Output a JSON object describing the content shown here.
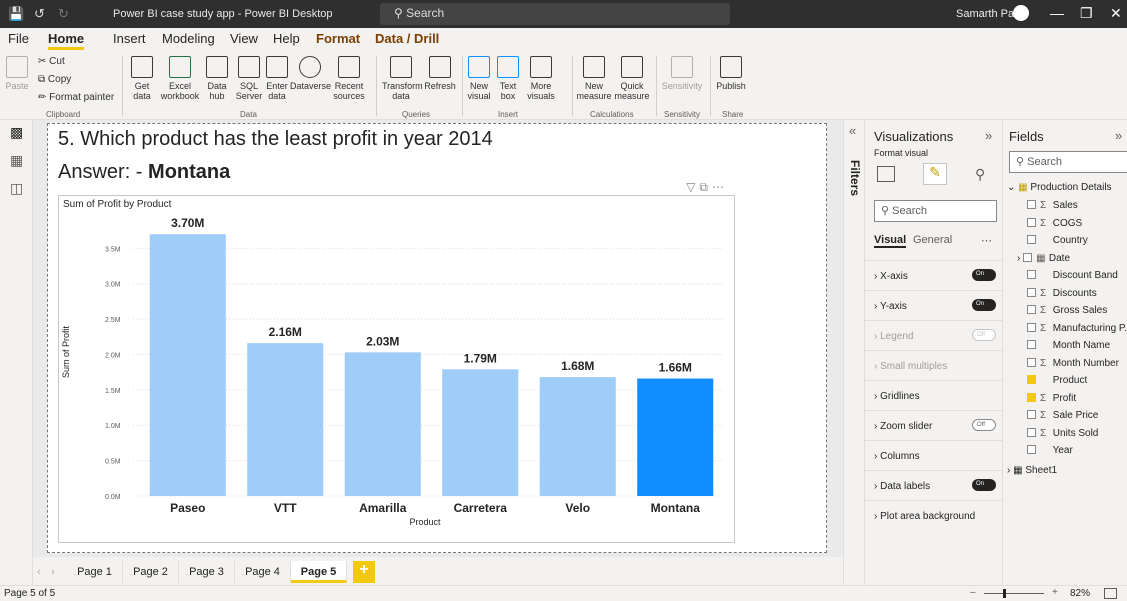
{
  "titlebar": {
    "doc_title": "Power BI case study app - Power BI Desktop",
    "search_placeholder": "Search",
    "user": "Samarth Patil"
  },
  "menu": [
    "File",
    "Home",
    "Insert",
    "Modeling",
    "View",
    "Help",
    "Format",
    "Data / Drill"
  ],
  "ribbon": {
    "clipboard": {
      "paste": "Paste",
      "cut": "Cut",
      "copy": "Copy",
      "format_painter": "Format painter",
      "group": "Clipboard"
    },
    "data": {
      "items": [
        "Get data",
        "Excel workbook",
        "Data hub",
        "SQL Server",
        "Enter data",
        "Dataverse",
        "Recent sources"
      ],
      "group": "Data"
    },
    "queries": {
      "items": [
        "Transform data",
        "Refresh"
      ],
      "group": "Queries"
    },
    "insert": {
      "items": [
        "New visual",
        "Text box",
        "More visuals"
      ],
      "group": "Insert"
    },
    "calculations": {
      "items": [
        "New measure",
        "Quick measure"
      ],
      "group": "Calculations"
    },
    "sensitivity": {
      "items": [
        "Sensitivity"
      ],
      "group": "Sensitivity"
    },
    "share": {
      "items": [
        "Publish"
      ],
      "group": "Share"
    }
  },
  "report": {
    "question": "5. Which product has the least profit in year 2014",
    "answer_prefix": "Answer: - ",
    "answer": "Montana"
  },
  "chart_data": {
    "type": "bar",
    "title": "Sum of Profit by Product",
    "xlabel": "Product",
    "ylabel": "Sum of Profit",
    "categories": [
      "Paseo",
      "VTT",
      "Amarilla",
      "Carretera",
      "Velo",
      "Montana"
    ],
    "values": [
      3.7,
      2.16,
      2.03,
      1.79,
      1.68,
      1.66
    ],
    "value_unit": "M",
    "data_labels": [
      "3.70M",
      "2.16M",
      "2.03M",
      "1.79M",
      "1.68M",
      "1.66M"
    ],
    "y_ticks": [
      "0.0M",
      "0.5M",
      "1.0M",
      "1.5M",
      "2.0M",
      "2.5M",
      "3.0M",
      "3.5M"
    ],
    "ylim": [
      0,
      3.9
    ],
    "grid": true,
    "bar_color": "#9fcdf8",
    "highlight_color": "#118dff",
    "highlight_category": "Montana"
  },
  "filters_label": "Filters",
  "visualizations": {
    "title": "Visualizations",
    "format_visual": "Format visual",
    "search_placeholder": "Search",
    "tabs": [
      "Visual",
      "General"
    ],
    "sections": [
      {
        "label": "X-axis",
        "toggle": "On",
        "state": "on"
      },
      {
        "label": "Y-axis",
        "toggle": "On",
        "state": "on"
      },
      {
        "label": "Legend",
        "toggle": "Off",
        "state": "disabled"
      },
      {
        "label": "Small multiples",
        "toggle": "",
        "state": "disabled"
      },
      {
        "label": "Gridlines",
        "toggle": "",
        "state": "normal"
      },
      {
        "label": "Zoom slider",
        "toggle": "Off",
        "state": "off"
      },
      {
        "label": "Columns",
        "toggle": "",
        "state": "normal"
      },
      {
        "label": "Data labels",
        "toggle": "On",
        "state": "on"
      },
      {
        "label": "Plot area background",
        "toggle": "",
        "state": "normal"
      }
    ]
  },
  "fields": {
    "title": "Fields",
    "search_placeholder": "Search",
    "table": "Production Details",
    "items": [
      {
        "label": "Sales",
        "sigma": true,
        "checked": false
      },
      {
        "label": "COGS",
        "sigma": true,
        "checked": false
      },
      {
        "label": "Country",
        "sigma": false,
        "checked": false
      },
      {
        "label": "Date",
        "sigma": false,
        "checked": false,
        "hierarchy": true
      },
      {
        "label": "Discount Band",
        "sigma": false,
        "checked": false
      },
      {
        "label": "Discounts",
        "sigma": true,
        "checked": false
      },
      {
        "label": "Gross Sales",
        "sigma": true,
        "checked": false
      },
      {
        "label": "Manufacturing P...",
        "sigma": true,
        "checked": false
      },
      {
        "label": "Month Name",
        "sigma": false,
        "checked": false
      },
      {
        "label": "Month Number",
        "sigma": true,
        "checked": false
      },
      {
        "label": "Product",
        "sigma": false,
        "checked": true
      },
      {
        "label": "Profit",
        "sigma": true,
        "checked": true
      },
      {
        "label": "Sale Price",
        "sigma": true,
        "checked": false
      },
      {
        "label": "Units Sold",
        "sigma": true,
        "checked": false
      },
      {
        "label": "Year",
        "sigma": false,
        "checked": false
      }
    ],
    "sheet": "Sheet1"
  },
  "pages": [
    "Page 1",
    "Page 2",
    "Page 3",
    "Page 4",
    "Page 5"
  ],
  "active_page": "Page 5",
  "status": {
    "page_count": "Page 5 of 5",
    "zoom": "82%"
  }
}
